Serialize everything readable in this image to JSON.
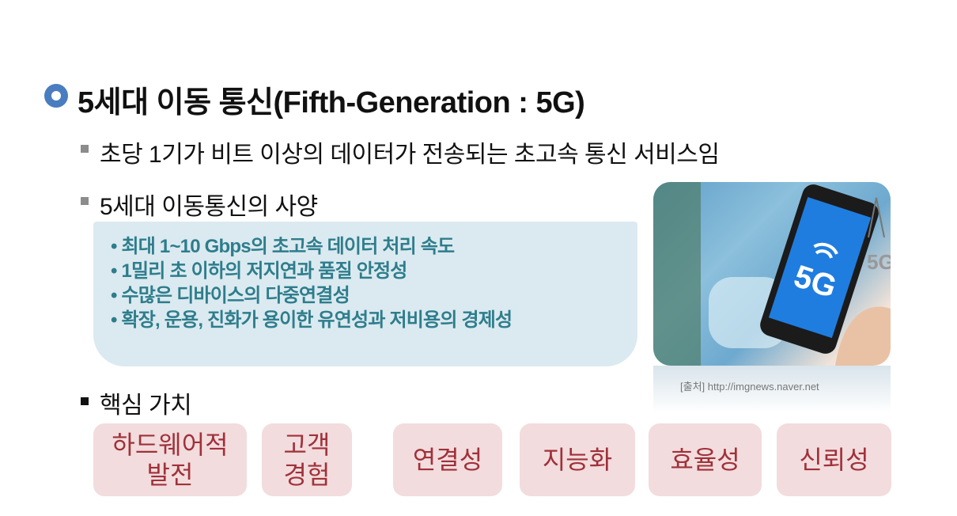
{
  "slide": {
    "title": "5세대 이동 통신(Fifth-Generation : 5G)",
    "bullets": [
      "초당 1기가 비트 이상의 데이터가 전송되는 초고속 통신 서비스임",
      "5세대 이동통신의 사양"
    ],
    "specs": [
      "최대 1~10 Gbps의 초고속 데이터 처리 속도",
      "1밀리 초 이하의 저지연과 품질 안정성",
      "수많은 디바이스의 다중연결성",
      "확장, 운용, 진화가 용이한 유연성과 저비용의 경제성"
    ],
    "core_heading": "핵심 가치",
    "core_values": [
      "하드웨어적\n발전",
      "고객\n경험",
      "연결성",
      "지능화",
      "효율성",
      "신뢰성"
    ],
    "image": {
      "phone_label": "5G",
      "tower_label": "5G",
      "caption": "[출처] http://imgnews.naver.net"
    }
  },
  "colors": {
    "accent": "#4a7cc0",
    "spec_bg": "#dbeaf0",
    "spec_text": "#2e7d8c",
    "value_bg": "#f2dcdd",
    "value_text": "#a0313a"
  }
}
